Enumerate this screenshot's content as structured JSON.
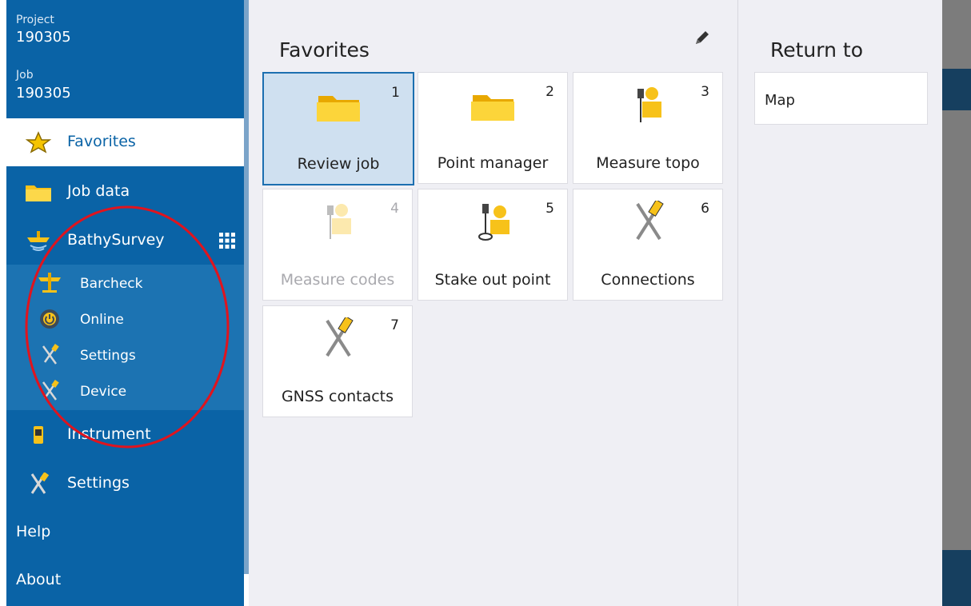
{
  "sidebar": {
    "project_label": "Project",
    "project_value": "190305",
    "job_label": "Job",
    "job_value": "190305",
    "items": [
      {
        "label": "Favorites",
        "icon": "star-icon"
      },
      {
        "label": "Job data",
        "icon": "folder-icon"
      },
      {
        "label": "BathySurvey",
        "icon": "boat-sonar-icon"
      },
      {
        "label": "Instrument",
        "icon": "instrument-icon"
      },
      {
        "label": "Settings",
        "icon": "tools-icon"
      },
      {
        "label": "Help"
      },
      {
        "label": "About"
      }
    ],
    "subitems": [
      {
        "label": "Barcheck",
        "icon": "barcheck-icon"
      },
      {
        "label": "Online",
        "icon": "power-icon"
      },
      {
        "label": "Settings",
        "icon": "tools-icon"
      },
      {
        "label": "Device",
        "icon": "tools-icon"
      }
    ]
  },
  "main": {
    "title": "Favorites",
    "tiles": [
      {
        "num": "1",
        "label": "Review job",
        "icon": "folder-icon"
      },
      {
        "num": "2",
        "label": "Point manager",
        "icon": "folder-icon"
      },
      {
        "num": "3",
        "label": "Measure topo",
        "icon": "surveyor-icon"
      },
      {
        "num": "4",
        "label": "Measure codes",
        "icon": "surveyor-icon"
      },
      {
        "num": "5",
        "label": "Stake out point",
        "icon": "stakeout-icon"
      },
      {
        "num": "6",
        "label": "Connections",
        "icon": "tools-icon"
      },
      {
        "num": "7",
        "label": "GNSS contacts",
        "icon": "tools-icon"
      }
    ]
  },
  "right": {
    "title": "Return to",
    "map_label": "Map"
  },
  "colors": {
    "sidebar": "#0a63a6",
    "accent": "#1c6fb0",
    "annotation": "#e0141e"
  }
}
